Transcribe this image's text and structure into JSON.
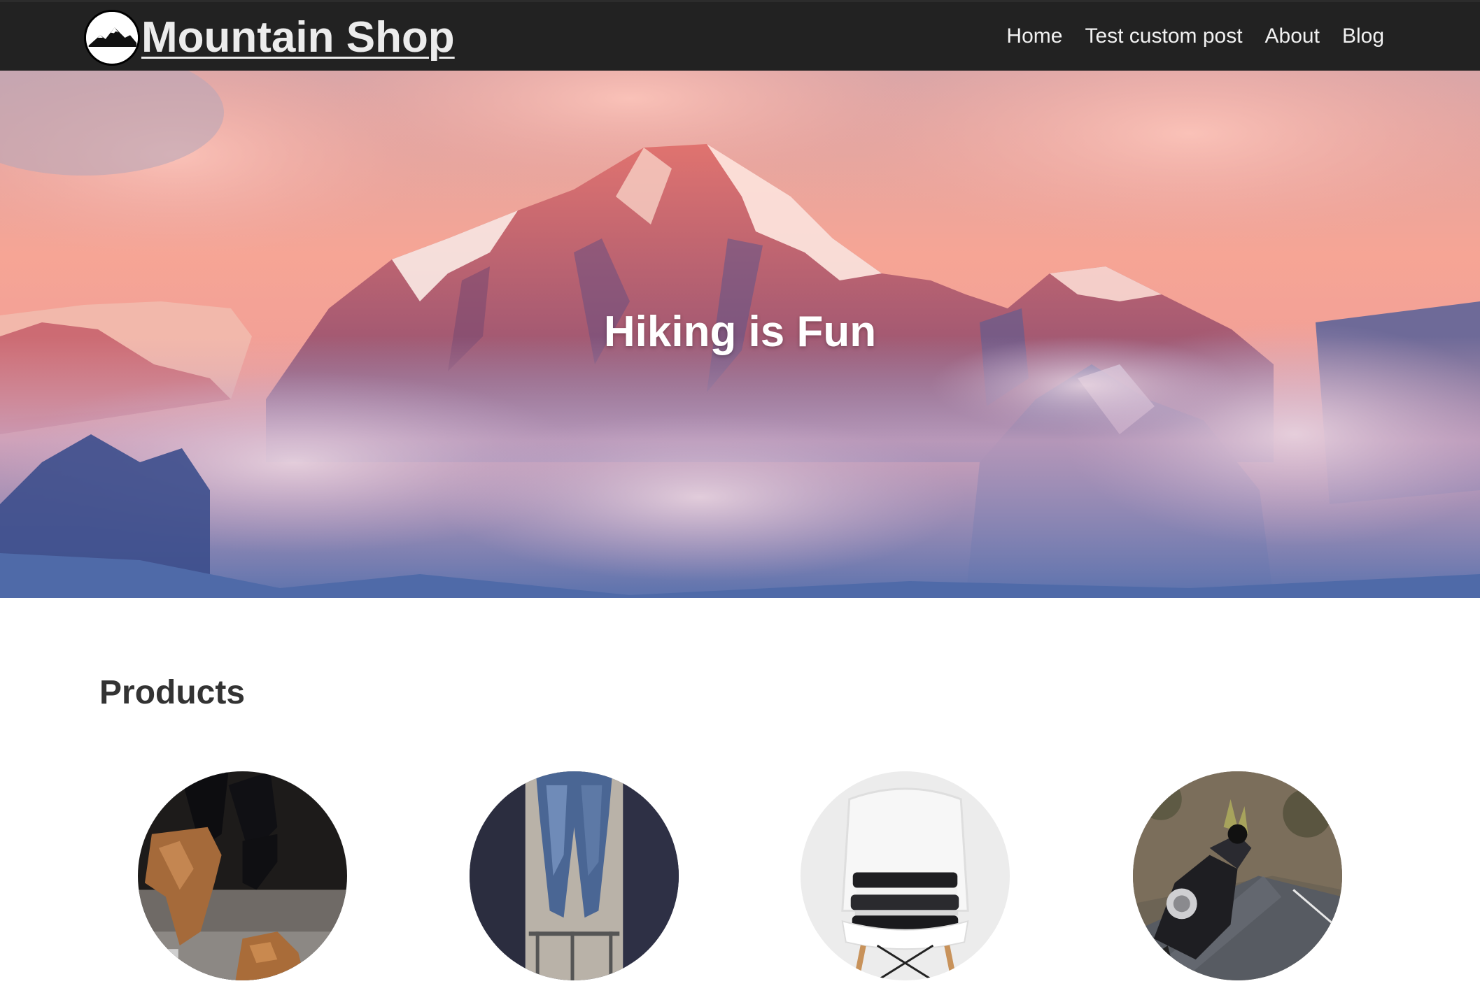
{
  "header": {
    "brand": {
      "title": "Mountain Shop",
      "logo_icon": "mountain-logo-icon"
    },
    "nav": [
      {
        "label": "Home"
      },
      {
        "label": "Test custom post"
      },
      {
        "label": "About"
      },
      {
        "label": "Blog"
      }
    ],
    "background_color": "#222222"
  },
  "hero": {
    "title": "Hiking is Fun",
    "image": "snowy-mountain-peaks-at-sunset-image"
  },
  "products": {
    "heading": "Products",
    "items": [
      {
        "image": "brown-ankle-boots-image"
      },
      {
        "image": "hanging-jeans-image"
      },
      {
        "image": "folded-clothes-on-white-chair-image"
      },
      {
        "image": "motorcycle-rider-on-road-image"
      }
    ]
  }
}
